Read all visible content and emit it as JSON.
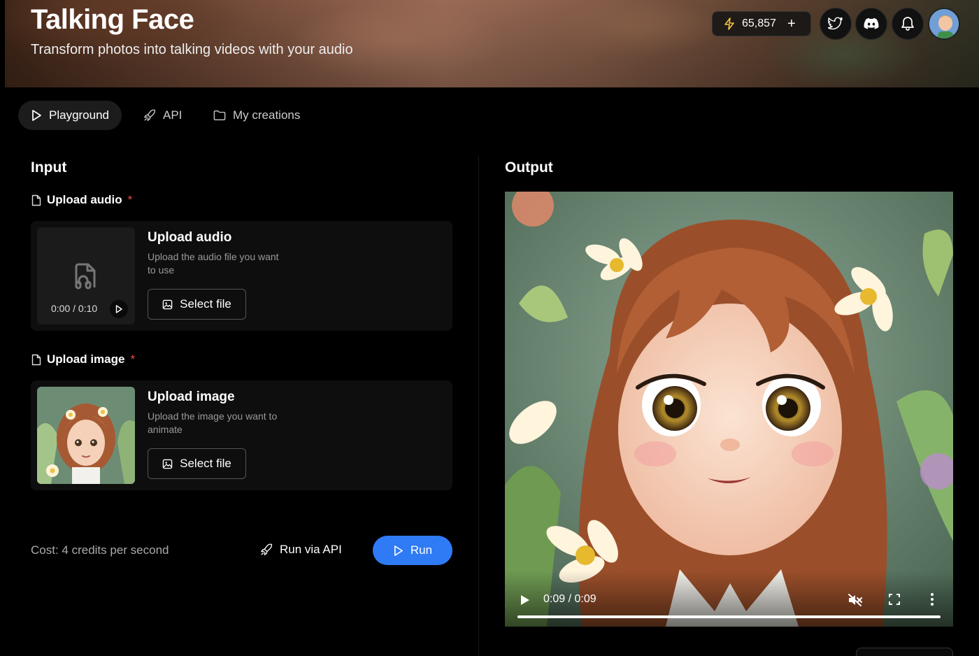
{
  "header": {
    "title": "Talking Face",
    "subtitle": "Transform photos into talking videos with your audio",
    "credits": "65,857"
  },
  "tabs": [
    {
      "label": "Playground",
      "icon": "play-icon",
      "active": true
    },
    {
      "label": "API",
      "icon": "rocket-icon",
      "active": false
    },
    {
      "label": "My creations",
      "icon": "folder-icon",
      "active": false
    }
  ],
  "input": {
    "title": "Input",
    "audio": {
      "label": "Upload audio",
      "required_mark": "*",
      "card_title": "Upload audio",
      "description": "Upload the audio file you want to use",
      "button": "Select file",
      "time": "0:00 / 0:10"
    },
    "image": {
      "label": "Upload image",
      "required_mark": "*",
      "card_title": "Upload image",
      "description": "Upload the image you want to animate",
      "button": "Select file"
    },
    "cost": "Cost: 4 credits per second",
    "run_via_api": "Run via API",
    "run": "Run"
  },
  "output": {
    "title": "Output",
    "video_time": "0:09 / 0:09",
    "progress": 1.0
  },
  "colors": {
    "accent": "#2f7bf6",
    "required": "#e64b4b",
    "credits_icon": "#f5c542"
  }
}
